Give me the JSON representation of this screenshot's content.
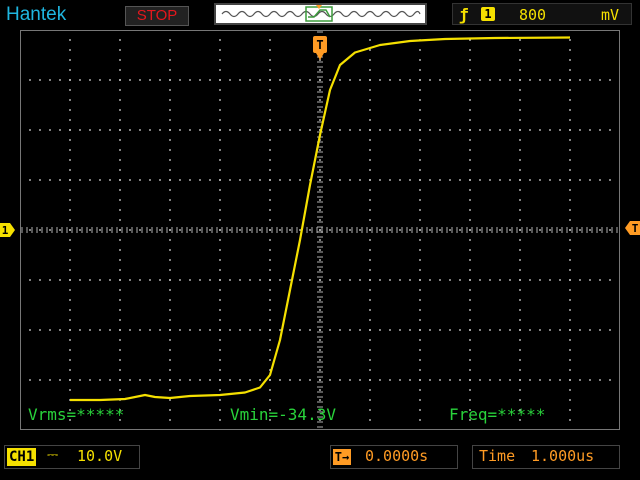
{
  "header": {
    "brand": "Hantek",
    "run_state": "STOP",
    "trigger": {
      "source_channel": "1",
      "level_value": "800",
      "level_unit": "mV"
    }
  },
  "markers": {
    "channel1_ground": "1",
    "trigger_time": "T"
  },
  "measurements": {
    "vrms": "Vrms=*****",
    "vmin": "Vmin=-34.3V",
    "freq": "Freq=*****"
  },
  "footer": {
    "channel_label": "CH1",
    "coupling": "DC",
    "volts_per_div": "10.0V",
    "time_position": "0.0000s",
    "timebase_label": "Time",
    "timebase_value": "1.000us"
  },
  "colors": {
    "trace": "#f5e000",
    "grid": "#dddddd",
    "accent_orange": "#ff9b24",
    "measure_green": "#29d33b",
    "brand_cyan": "#1fb6e0",
    "stop_red": "#e4171d"
  },
  "waveform": {
    "description": "step response: low level, fast rise near trigger, settling high",
    "points": [
      [
        -5.0,
        -3.4
      ],
      [
        -4.4,
        -3.4
      ],
      [
        -3.9,
        -3.38
      ],
      [
        -3.5,
        -3.3
      ],
      [
        -3.3,
        -3.34
      ],
      [
        -3.0,
        -3.36
      ],
      [
        -2.6,
        -3.32
      ],
      [
        -2.0,
        -3.3
      ],
      [
        -1.5,
        -3.25
      ],
      [
        -1.2,
        -3.15
      ],
      [
        -1.0,
        -2.9
      ],
      [
        -0.8,
        -2.2
      ],
      [
        -0.6,
        -1.2
      ],
      [
        -0.4,
        -0.2
      ],
      [
        -0.2,
        0.9
      ],
      [
        0.0,
        1.9
      ],
      [
        0.2,
        2.8
      ],
      [
        0.4,
        3.3
      ],
      [
        0.7,
        3.55
      ],
      [
        1.2,
        3.7
      ],
      [
        1.8,
        3.78
      ],
      [
        2.5,
        3.82
      ],
      [
        3.5,
        3.84
      ],
      [
        5.0,
        3.85
      ]
    ]
  }
}
